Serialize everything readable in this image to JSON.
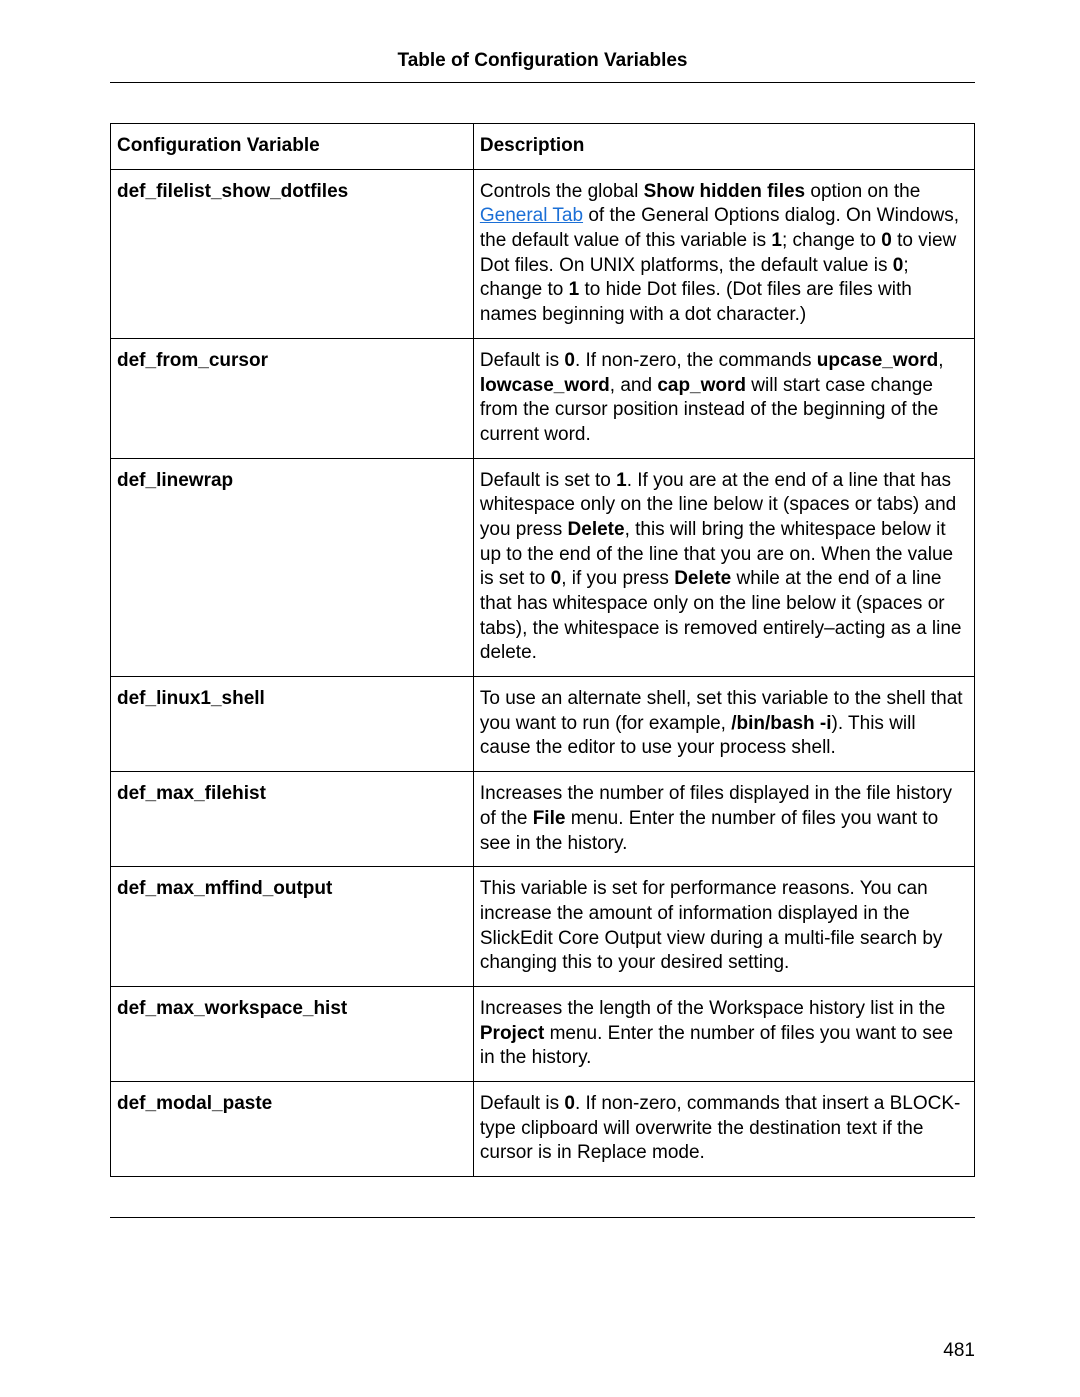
{
  "page_title": "Table of Configuration Variables",
  "page_number": "481",
  "columns": {
    "var": "Configuration Variable",
    "desc": "Description"
  },
  "strings": {
    "show_hidden_files": "Show hidden files",
    "general_tab": "General Tab",
    "file_menu": "File",
    "project_menu": "Project",
    "delete_key": "Delete",
    "bin_bash_i": "/bin/bash -i",
    "upcase_word": "upcase_word",
    "lowcase_word": "lowcase_word",
    "cap_word": "cap_word",
    "zero": "0",
    "one": "1"
  },
  "rows": [
    {
      "name": "def_filelist_show_dotfiles"
    },
    {
      "name": "def_from_cursor"
    },
    {
      "name": "def_linewrap"
    },
    {
      "name": "def_linux1_shell"
    },
    {
      "name": "def_max_filehist"
    },
    {
      "name": "def_max_mffind_output"
    },
    {
      "name": "def_max_workspace_hist"
    },
    {
      "name": "def_modal_paste"
    }
  ],
  "desc_plain": {
    "r0_a": "Controls the global ",
    "r0_b": " option on the ",
    "r0_c": " of the General Options dialog. On Windows, the default value of this variable is ",
    "r0_d": "; change to ",
    "r0_e": " to view Dot files. On UNIX platforms, the default value is ",
    "r0_f": "; change to ",
    "r0_g": " to hide Dot files. (Dot files are files with names beginning with a dot character.)",
    "r1_a": "Default is ",
    "r1_b": ". If non-zero, the commands ",
    "r1_c": ", ",
    "r1_d": ", and ",
    "r1_e": " will start case change from the cursor position instead of the beginning of the current word.",
    "r2_a": "Default is set to ",
    "r2_b": ". If you are at the end of a line that has whitespace only on the line below it (spaces or tabs) and you press ",
    "r2_c": ", this will bring the whitespace below it up to the end of the line that you are on. When the value is set to ",
    "r2_d": ", if you press ",
    "r2_e": " while at the end of a line that has whitespace only on the line below it (spaces or tabs), the whitespace is removed entirely–acting as a line delete.",
    "r3_a": "To use an alternate shell, set this variable to the shell that you want to run (for example, ",
    "r3_b": "). This will cause the editor to use your process shell.",
    "r4_a": "Increases the number of files displayed in the file history of the ",
    "r4_b": " menu. Enter the number of files you want to see in the history.",
    "r5_a": "This variable is set for performance reasons. You can increase the amount of information displayed in the SlickEdit Core Output view during a multi-file search by changing this to your desired setting.",
    "r6_a": "Increases the length of the Workspace history list in the ",
    "r6_b": " menu. Enter the number of files you want to see in the history.",
    "r7_a": "Default is ",
    "r7_b": ". If non-zero, commands that insert a BLOCK-type clipboard will overwrite the destination text if the cursor is in Replace mode."
  }
}
